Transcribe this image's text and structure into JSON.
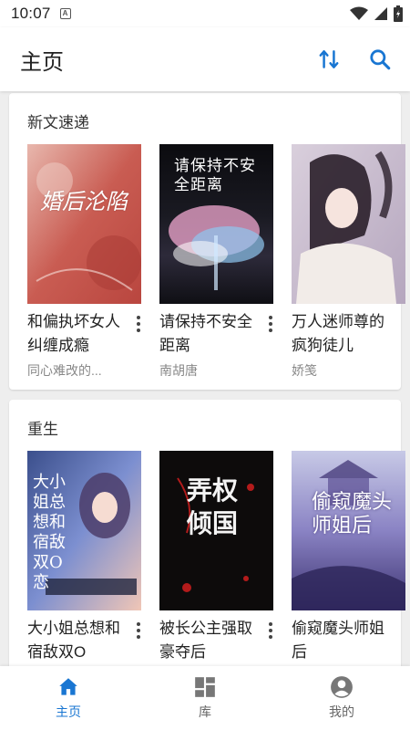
{
  "status_bar": {
    "time": "10:07",
    "notification_glyph": "A"
  },
  "app_bar": {
    "title": "主页"
  },
  "sections": [
    {
      "title": "新文速递",
      "books": [
        {
          "title": "和偏执坏女人纠缠成瘾",
          "author": "同心难改的..."
        },
        {
          "title": "请保持不安全距离",
          "author": "南胡唐"
        },
        {
          "title": "万人迷师尊的疯狗徒儿",
          "author": "娇笺"
        }
      ]
    },
    {
      "title": "重生",
      "books": [
        {
          "title": "大小姐总想和宿敌双O",
          "author": ""
        },
        {
          "title": "被长公主强取豪夺后",
          "author": ""
        },
        {
          "title": "偷窥魔头师姐后",
          "author": ""
        }
      ]
    }
  ],
  "covers": [
    {
      "text": "婚后沦陷"
    },
    {
      "text": "请保持不安全距离"
    },
    {
      "text": ""
    },
    {
      "text": "大小姐总想和宿敌双O恋"
    },
    {
      "text": "弄权倾国"
    },
    {
      "text": "偷窥魔头师姐后"
    }
  ],
  "bottom_nav": [
    {
      "label": "主页",
      "active": true
    },
    {
      "label": "库",
      "active": false
    },
    {
      "label": "我的",
      "active": false
    }
  ],
  "colors": {
    "accent": "#1976d2",
    "background": "#eeeeee",
    "card": "#ffffff"
  }
}
